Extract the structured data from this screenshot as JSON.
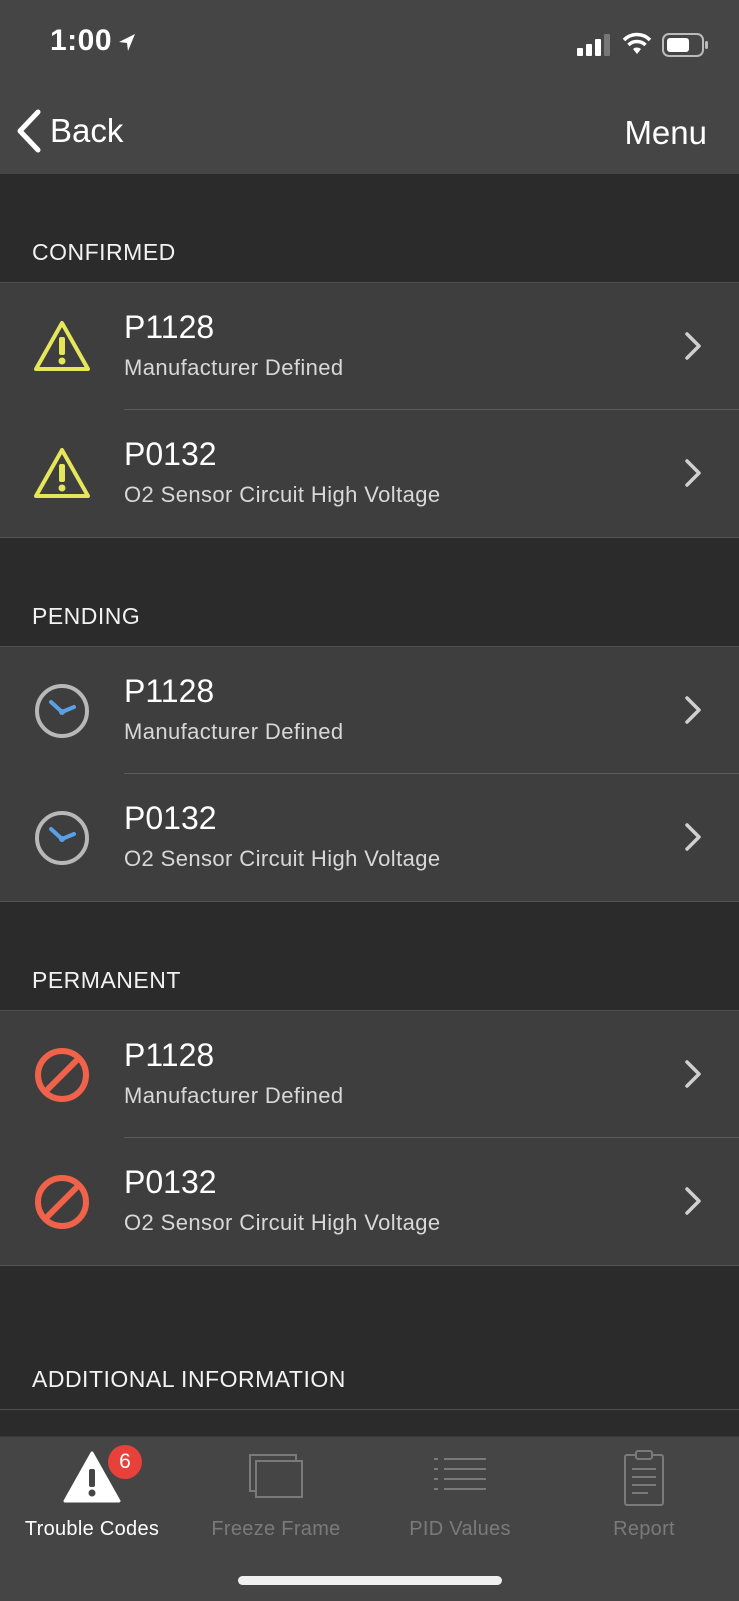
{
  "status_bar": {
    "time": "1:00"
  },
  "nav": {
    "back_label": "Back",
    "menu_label": "Menu"
  },
  "sections": [
    {
      "title": "CONFIRMED",
      "icon": "warning-triangle-icon",
      "icon_color": "#e6e65a",
      "items": [
        {
          "code": "P1128",
          "description": "Manufacturer Defined"
        },
        {
          "code": "P0132",
          "description": "O2 Sensor Circuit High Voltage"
        }
      ]
    },
    {
      "title": "PENDING",
      "icon": "clock-icon",
      "icon_color": "#5aa0e6",
      "items": [
        {
          "code": "P1128",
          "description": "Manufacturer Defined"
        },
        {
          "code": "P0132",
          "description": "O2 Sensor Circuit High Voltage"
        }
      ]
    },
    {
      "title": "PERMANENT",
      "icon": "prohibited-icon",
      "icon_color": "#f0634a",
      "items": [
        {
          "code": "P1128",
          "description": "Manufacturer Defined"
        },
        {
          "code": "P0132",
          "description": "O2 Sensor Circuit High Voltage"
        }
      ]
    },
    {
      "title": "ADDITIONAL INFORMATION",
      "items": []
    }
  ],
  "tab_bar": {
    "tabs": [
      {
        "label": "Trouble Codes",
        "icon": "warning-icon",
        "active": true,
        "badge": "6"
      },
      {
        "label": "Freeze Frame",
        "icon": "frames-icon",
        "active": false
      },
      {
        "label": "PID Values",
        "icon": "list-icon",
        "active": false
      },
      {
        "label": "Report",
        "icon": "clipboard-icon",
        "active": false
      }
    ]
  }
}
